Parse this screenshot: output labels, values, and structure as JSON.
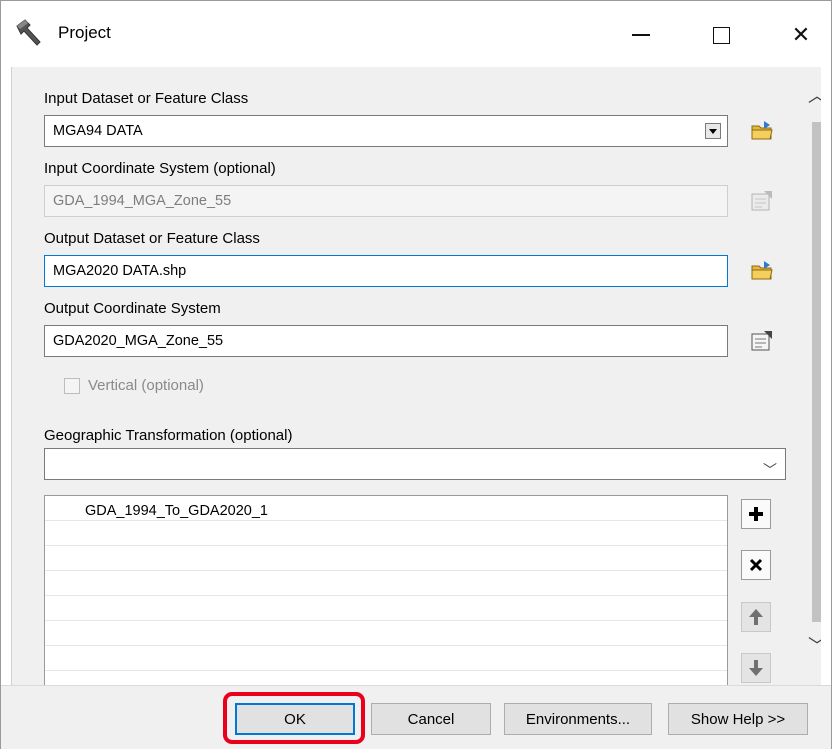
{
  "window": {
    "title": "Project"
  },
  "fields": {
    "input_dataset_label": "Input Dataset or Feature Class",
    "input_dataset_value": "MGA94 DATA",
    "input_cs_label": "Input Coordinate System (optional)",
    "input_cs_value": "GDA_1994_MGA_Zone_55",
    "output_dataset_label": "Output Dataset or Feature Class",
    "output_dataset_value": "MGA2020 DATA.shp",
    "output_cs_label": "Output Coordinate System",
    "output_cs_value": "GDA2020_MGA_Zone_55",
    "vertical_label": "Vertical (optional)",
    "geo_transform_label": "Geographic Transformation (optional)",
    "geo_transform_value": ""
  },
  "transform_list": [
    "GDA_1994_To_GDA2020_1",
    "",
    "",
    "",
    "",
    "",
    ""
  ],
  "footer": {
    "ok_label": "OK",
    "cancel_label": "Cancel",
    "environments_label": "Environments...",
    "help_label": "Show Help >>"
  },
  "colors": {
    "highlight": "#e8001c",
    "focus": "#0078d7"
  }
}
